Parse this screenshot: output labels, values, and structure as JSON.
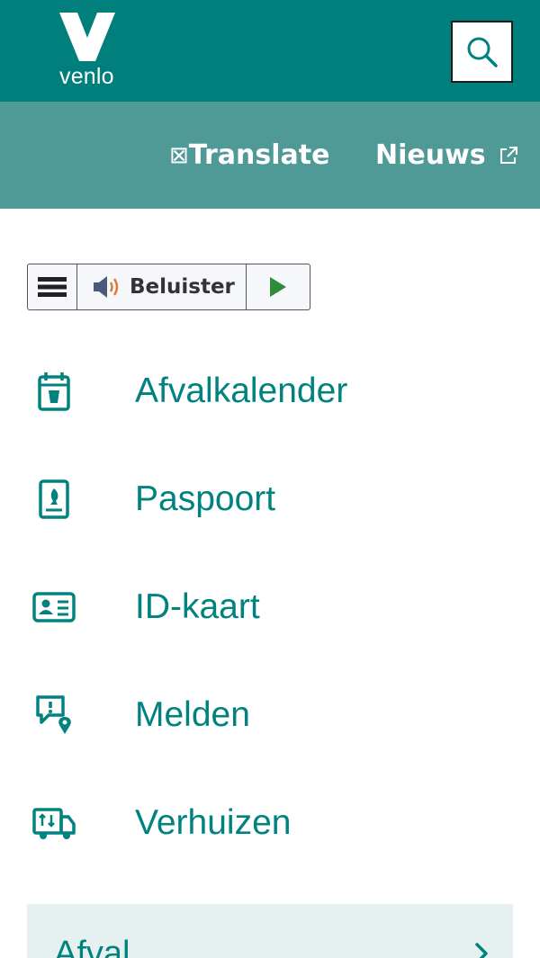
{
  "brand": {
    "logo_text": "venlo"
  },
  "colors": {
    "header_bg": "#007f7c",
    "subnav_bg": "#4f9a97",
    "accent": "#00827f",
    "panel_bg": "#e6f0f0"
  },
  "header": {
    "search_icon": "search-icon"
  },
  "subnav": {
    "translate_box": "⊠",
    "translate_label": "Translate",
    "news_label": "Nieuws",
    "news_icon": "external-link-icon"
  },
  "readspeaker": {
    "menu_icon": "menu-icon",
    "listen_icon": "speaker-icon",
    "listen_label": "Beluister",
    "play_icon": "play-icon"
  },
  "quick_links": [
    {
      "icon": "waste-calendar-icon",
      "label": "Afvalkalender"
    },
    {
      "icon": "passport-icon",
      "label": "Paspoort"
    },
    {
      "icon": "id-card-icon",
      "label": "ID-kaart"
    },
    {
      "icon": "report-location-icon",
      "label": "Melden"
    },
    {
      "icon": "moving-truck-icon",
      "label": "Verhuizen"
    }
  ],
  "panel": {
    "label": "Afval",
    "icon": "chevron-right-icon"
  }
}
